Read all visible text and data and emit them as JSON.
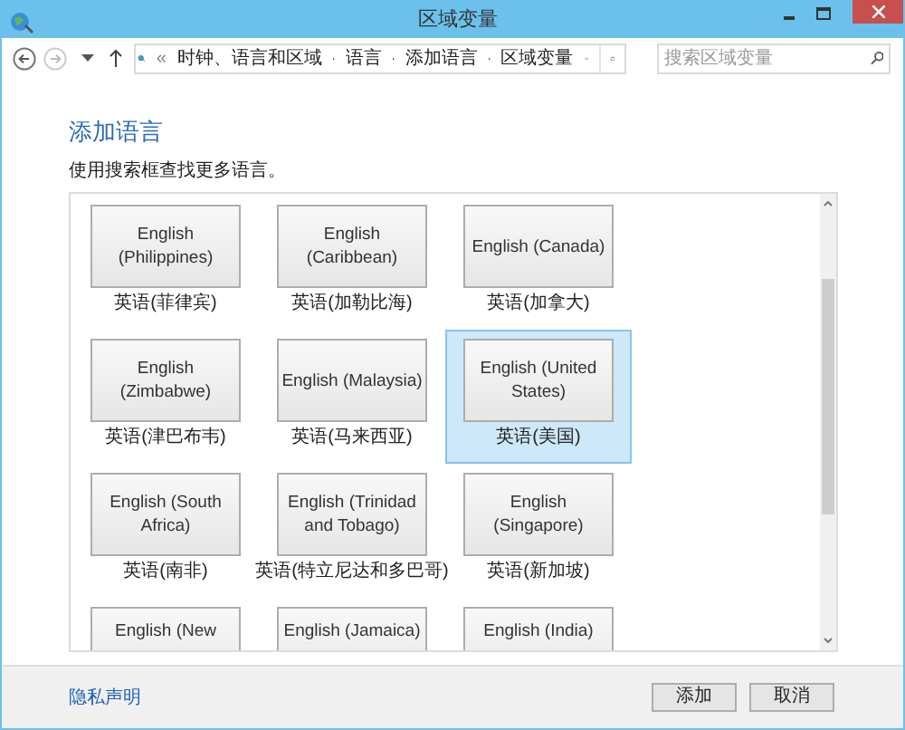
{
  "window": {
    "title": "区域变量"
  },
  "address_bar": {
    "prefix": "«",
    "crumbs": [
      "时钟、语言和区域",
      "语言",
      "添加语言",
      "区域变量"
    ]
  },
  "search": {
    "placeholder": "搜索区域变量"
  },
  "heading": "添加语言",
  "instruction": "使用搜索框查找更多语言。",
  "languages": [
    {
      "name": "English (Philippines)",
      "native": "英语(菲律宾)",
      "selected": false
    },
    {
      "name": "English (Caribbean)",
      "native": "英语(加勒比海)",
      "selected": false
    },
    {
      "name": "English (Canada)",
      "native": "英语(加拿大)",
      "selected": false
    },
    {
      "name": "English (Zimbabwe)",
      "native": "英语(津巴布韦)",
      "selected": false
    },
    {
      "name": "English (Malaysia)",
      "native": "英语(马来西亚)",
      "selected": false
    },
    {
      "name": "English (United States)",
      "native": "英语(美国)",
      "selected": true
    },
    {
      "name": "English (South Africa)",
      "native": "英语(南非)",
      "selected": false
    },
    {
      "name": "English (Trinidad and Tobago)",
      "native": "英语(特立尼达和多巴哥)",
      "selected": false
    },
    {
      "name": "English (Singapore)",
      "native": "英语(新加坡)",
      "selected": false
    },
    {
      "name": "English (New",
      "selected": false
    },
    {
      "name": "English (Jamaica)",
      "selected": false
    },
    {
      "name": "English (India)",
      "selected": false
    }
  ],
  "privacy_link": "隐私声明",
  "buttons": [
    "添加",
    "取消"
  ]
}
